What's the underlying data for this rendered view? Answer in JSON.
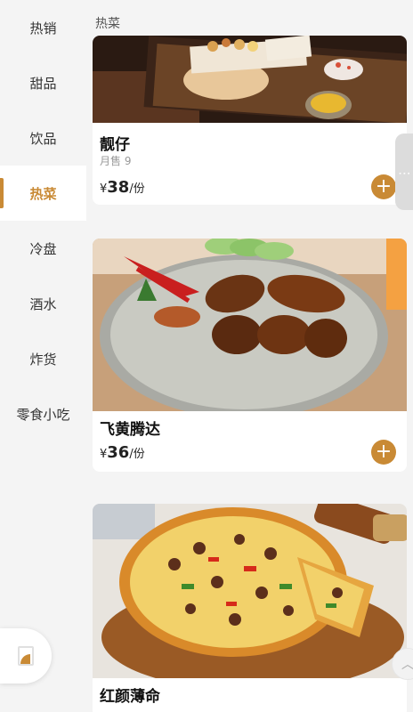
{
  "sidebar": {
    "active_index": 3,
    "items": [
      {
        "label": "热销"
      },
      {
        "label": "甜品"
      },
      {
        "label": "饮品"
      },
      {
        "label": "热菜"
      },
      {
        "label": "冷盘"
      },
      {
        "label": "酒水"
      },
      {
        "label": "炸货"
      },
      {
        "label": "零食小吃"
      }
    ]
  },
  "main": {
    "section_title": "热菜",
    "dishes": [
      {
        "name": "靓仔",
        "sales": "月售 9",
        "currency": "¥",
        "price": "38",
        "unit": "/份",
        "image": "fries-platter-photo"
      },
      {
        "name": "飞黄腾达",
        "currency": "¥",
        "price": "36",
        "unit": "/份",
        "image": "chicken-wings-photo"
      },
      {
        "name": "红颜薄命",
        "image": "pizza-photo"
      }
    ],
    "add_label": "+"
  },
  "floating": {
    "more_label": "⋮",
    "scroll_top_label": "︿"
  },
  "colors": {
    "accent": "#c98a35",
    "background": "#f4f4f4",
    "card": "#ffffff"
  }
}
